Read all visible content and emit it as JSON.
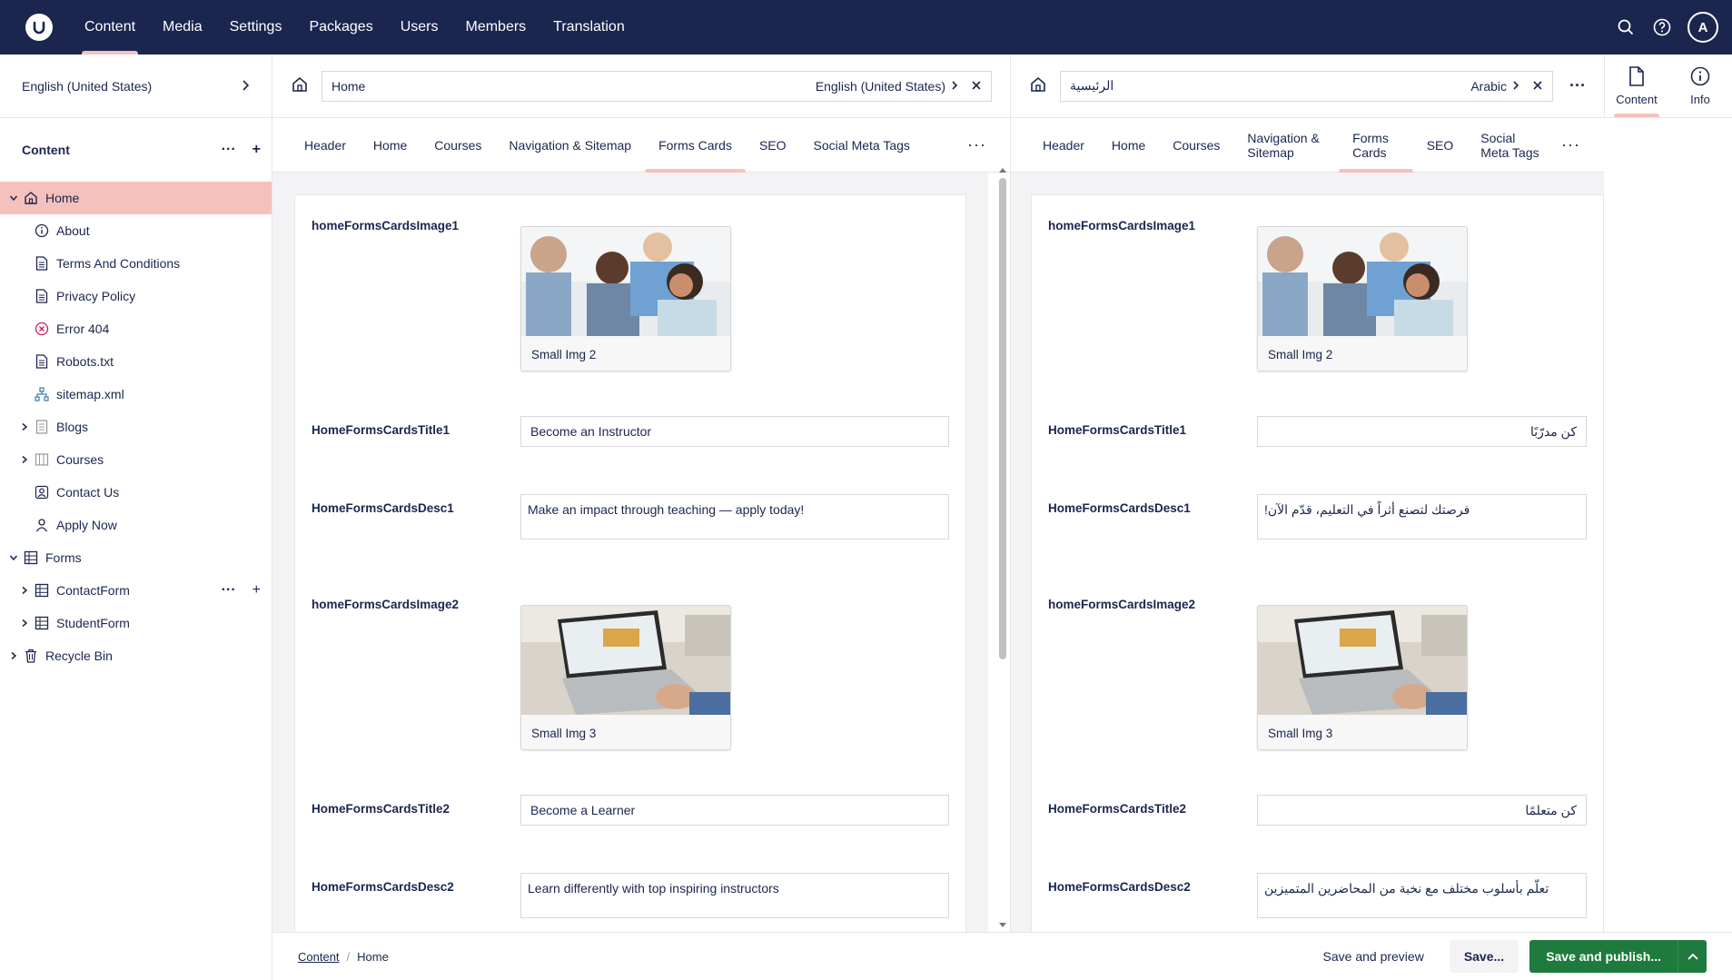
{
  "topnav": {
    "items": [
      "Content",
      "Media",
      "Settings",
      "Packages",
      "Users",
      "Members",
      "Translation"
    ],
    "avatar": "A"
  },
  "sidebar": {
    "culture": "English (United States)",
    "section_title": "Content",
    "tree": [
      {
        "label": "Home",
        "icon": "home-icon",
        "level": 0,
        "caret": "down",
        "selected": true
      },
      {
        "label": "About",
        "icon": "info-icon",
        "level": 1
      },
      {
        "label": "Terms And Conditions",
        "icon": "document-icon",
        "level": 1
      },
      {
        "label": "Privacy Policy",
        "icon": "document-icon",
        "level": 1
      },
      {
        "label": "Error 404",
        "icon": "error-icon",
        "level": 1
      },
      {
        "label": "Robots.txt",
        "icon": "document-icon",
        "level": 1
      },
      {
        "label": "sitemap.xml",
        "icon": "sitemap-icon",
        "level": 1
      },
      {
        "label": "Blogs",
        "icon": "list-icon",
        "level": 1,
        "caret": "right"
      },
      {
        "label": "Courses",
        "icon": "columns-icon",
        "level": 1,
        "caret": "right"
      },
      {
        "label": "Contact Us",
        "icon": "contact-icon",
        "level": 1
      },
      {
        "label": "Apply Now",
        "icon": "user-icon",
        "level": 1
      },
      {
        "label": "Forms",
        "icon": "grid-icon",
        "level": 0,
        "caret": "down"
      },
      {
        "label": "ContactForm",
        "icon": "grid-icon",
        "level": 1,
        "caret": "right",
        "actions": true
      },
      {
        "label": "StudentForm",
        "icon": "grid-icon",
        "level": 1,
        "caret": "right"
      },
      {
        "label": "Recycle Bin",
        "icon": "trash-icon",
        "level": 0,
        "caret": "right"
      }
    ]
  },
  "left_pane": {
    "name": "Home",
    "culture": "English (United States)",
    "tabs": [
      "Header",
      "Home",
      "Courses",
      "Navigation & Sitemap",
      "Forms Cards",
      "SEO",
      "Social Meta Tags"
    ],
    "active_tab": "Forms Cards",
    "fields": {
      "image1_label": "homeFormsCardsImage1",
      "image1_caption": "Small Img 2",
      "title1_label": "HomeFormsCardsTitle1",
      "title1_value": "Become an Instructor",
      "desc1_label": "HomeFormsCardsDesc1",
      "desc1_value": "Make an impact through teaching — apply today!",
      "image2_label": "homeFormsCardsImage2",
      "image2_caption": "Small Img 3",
      "title2_label": "HomeFormsCardsTitle2",
      "title2_value": "Become a Learner",
      "desc2_label": "HomeFormsCardsDesc2",
      "desc2_value": "Learn differently with top inspiring instructors"
    }
  },
  "right_pane": {
    "name": "الرئيسية",
    "culture": "Arabic",
    "tabs": [
      "Header",
      "Home",
      "Courses",
      "Navigation & Sitemap",
      "Forms Cards",
      "SEO",
      "Social Meta Tags"
    ],
    "active_tab": "Forms Cards",
    "fields": {
      "image1_label": "homeFormsCardsImage1",
      "image1_caption": "Small Img 2",
      "title1_label": "HomeFormsCardsTitle1",
      "title1_value": "كن مدرّبًا",
      "desc1_label": "HomeFormsCardsDesc1",
      "desc1_value": "فرصتك لتصنع أثراً في التعليم، قدّم الآن!",
      "image2_label": "homeFormsCardsImage2",
      "image2_caption": "Small Img 3",
      "title2_label": "HomeFormsCardsTitle2",
      "title2_value": "كن متعلمًا",
      "desc2_label": "HomeFormsCardsDesc2",
      "desc2_value": "تعلّم بأسلوب مختلف مع نخبة من المحاضرين المتميزين"
    }
  },
  "apps": {
    "content": "Content",
    "info": "Info"
  },
  "footer": {
    "breadcrumb": [
      "Content",
      "Home"
    ],
    "save_preview": "Save and preview",
    "save": "Save...",
    "publish": "Save and publish..."
  },
  "colors": {
    "topbar": "#1b264f",
    "accent": "#f5c1bc",
    "publish": "#1f7a3e",
    "text": "#1b264f"
  }
}
